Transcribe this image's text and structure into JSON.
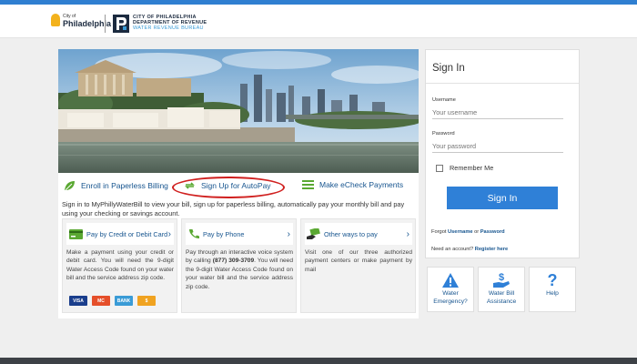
{
  "header": {
    "city_small": "City of",
    "city_name": "Philadelphia",
    "dept_line1": "CITY OF PHILADELPHIA",
    "dept_line2": "DEPARTMENT OF REVENUE",
    "dept_line3": "WATER REVENUE BUREAU"
  },
  "actions": {
    "paperless": "Enroll in Paperless Billing",
    "autopay": "Sign Up for AutoPay",
    "echeck": "Make eCheck Payments"
  },
  "intro": "Sign in to MyPhillyWaterBill to view your bill, sign up for paperless billing, automatically pay your monthly bill and pay using your checking or savings account.",
  "cards": [
    {
      "title": "Pay by Credit or Debit Card",
      "body": "Make a payment using your credit or debit card. You will need the 9-digit Water Access Code found on your water bill and the service address zip code.",
      "logos": [
        "VISA",
        "MC",
        "BANK",
        "$"
      ]
    },
    {
      "title": "Pay by Phone",
      "body_pre": "Pay through an interactive voice system by calling ",
      "phone": "(877) 309-3709",
      "body_post": ". You will need the 9-digit Water Access Code found on your water bill and the service address zip code."
    },
    {
      "title": "Other ways to pay",
      "body": "Visit one of our three authorized payment centers or make payment by mail"
    }
  ],
  "signin": {
    "title": "Sign In",
    "username_label": "Username",
    "username_placeholder": "Your username",
    "password_label": "Password",
    "password_placeholder": "Your password",
    "remember": "Remember Me",
    "button": "Sign In",
    "forgot_prefix": "Forgot ",
    "forgot_username": "Username",
    "forgot_or": " or ",
    "forgot_password": "Password",
    "need_prefix": "Need an account? ",
    "register": "Register here"
  },
  "tiles": [
    {
      "label": "Water Emergency?",
      "icon": "warning-icon"
    },
    {
      "label": "Water Bill Assistance",
      "icon": "assistance-icon"
    },
    {
      "label": "Help",
      "icon": "help-icon"
    }
  ],
  "colors": {
    "brand_blue": "#2f80d7",
    "link_blue": "#17558f",
    "highlight_red": "#d0201f"
  }
}
